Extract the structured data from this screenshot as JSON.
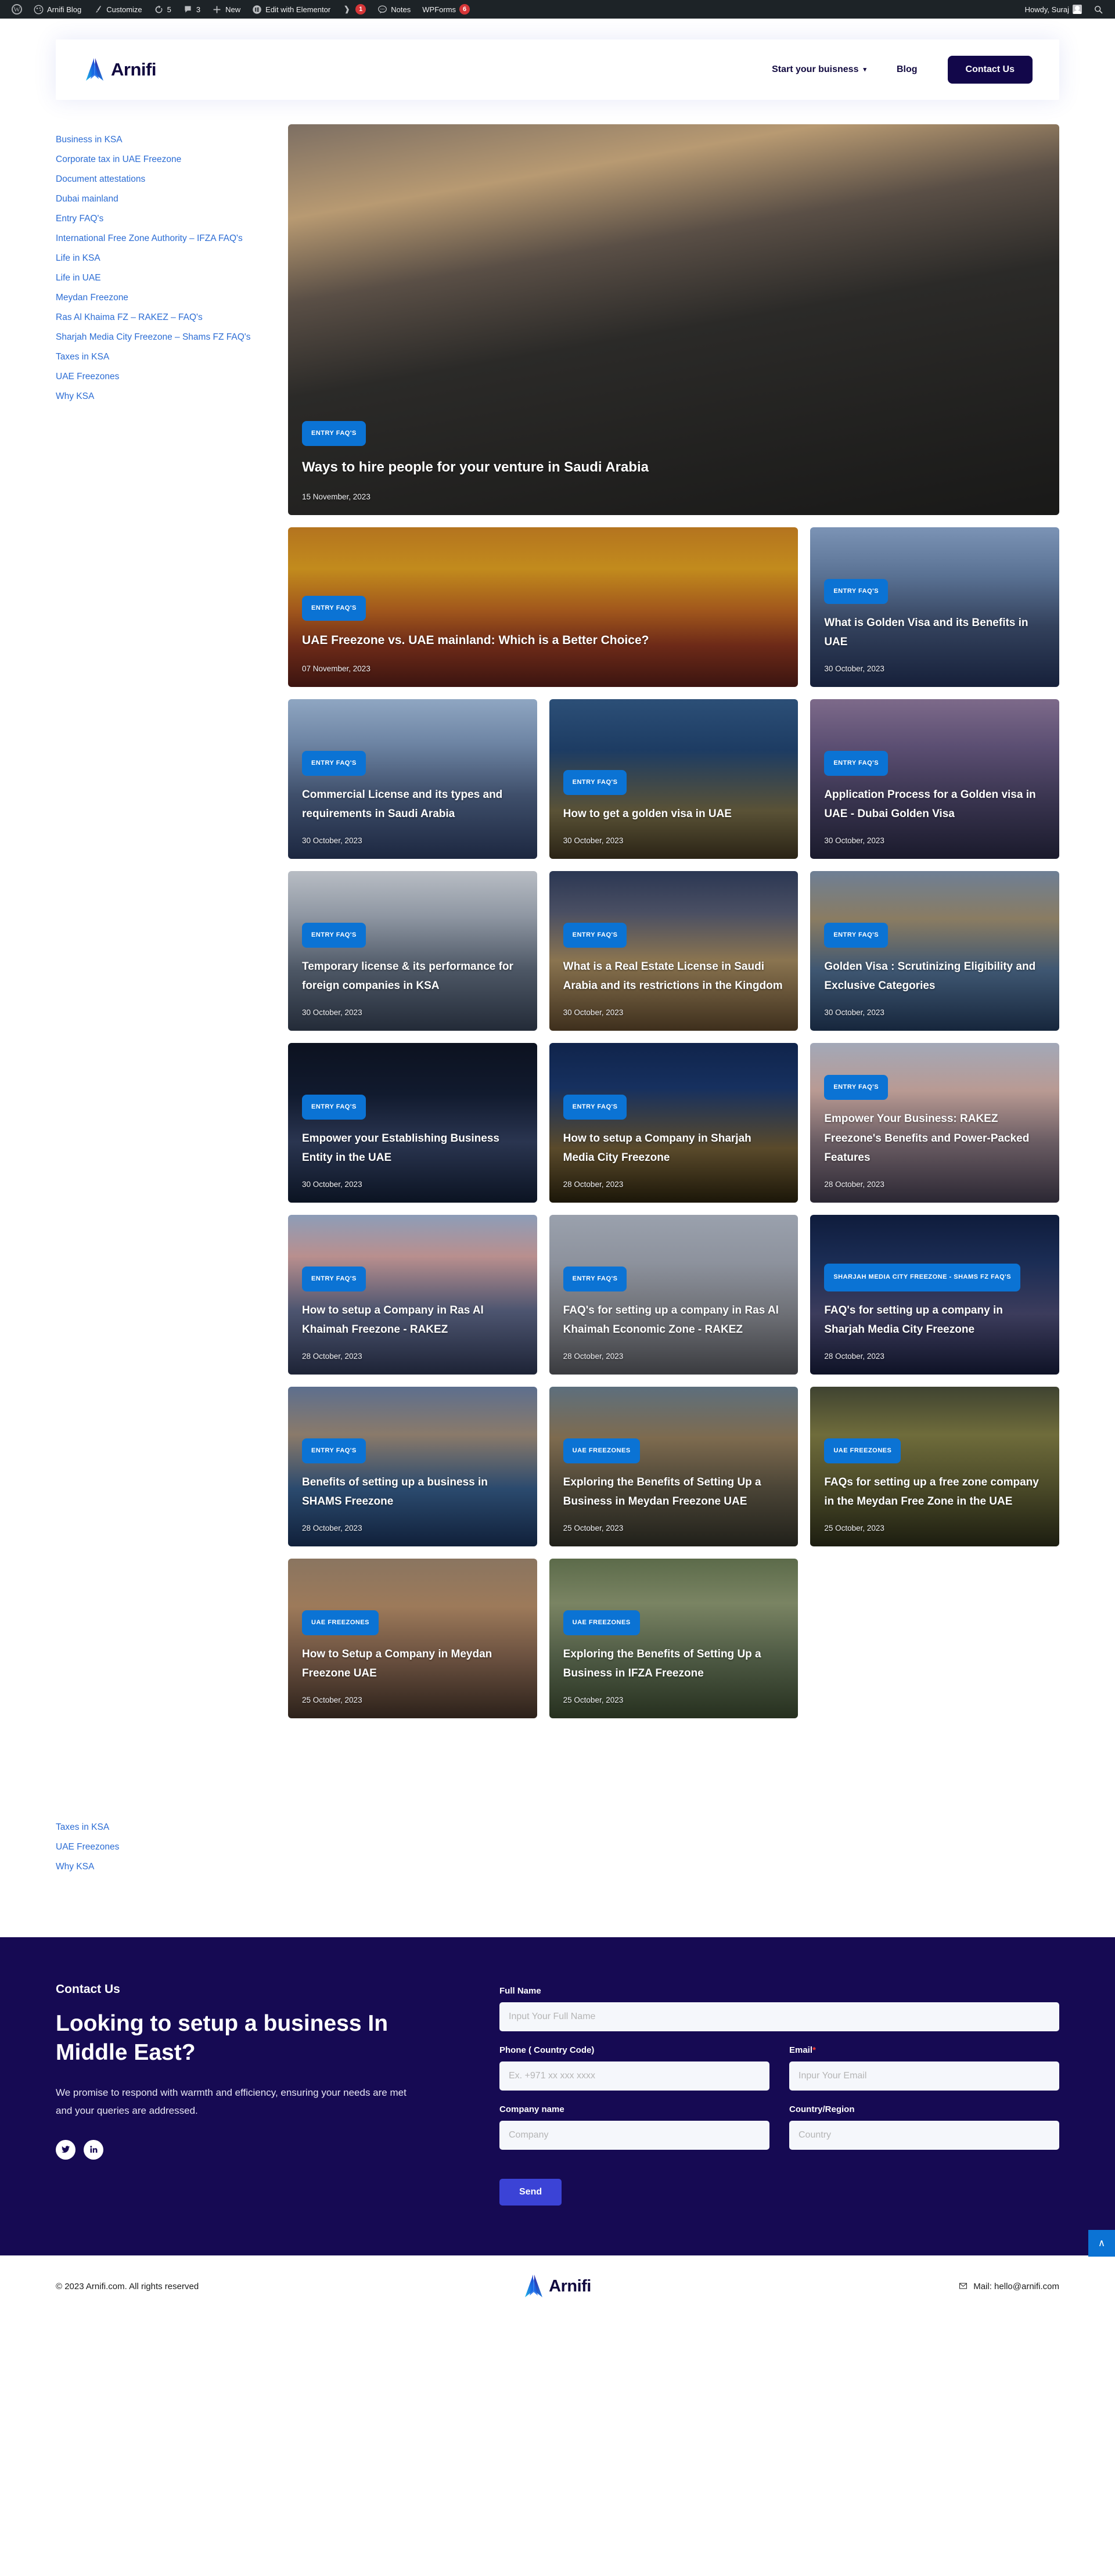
{
  "admin_bar": {
    "site_name": "Arnifi Blog",
    "customize": "Customize",
    "updates_count": "5",
    "comments_count": "3",
    "new": "New",
    "elementor": "Edit with Elementor",
    "yoast_badge": "1",
    "notes": "Notes",
    "wpforms": "WPForms",
    "wpforms_badge": "6",
    "howdy": "Howdy, Suraj"
  },
  "header": {
    "brand": "Arnifi",
    "nav": [
      {
        "label": "Start your buisness",
        "has_caret": true
      },
      {
        "label": "Blog",
        "has_caret": false
      }
    ],
    "cta": "Contact Us"
  },
  "sidebar": {
    "items": [
      "Business in KSA",
      "Corporate tax in UAE Freezone",
      "Document attestations",
      "Dubai mainland",
      "Entry FAQ's",
      "International Free Zone Authority – IFZA FAQ's",
      "Life in KSA",
      "Life in UAE",
      "Meydan Freezone",
      "Ras Al Khaima FZ – RAKEZ – FAQ's",
      "Sharjah Media City Freezone – Shams FZ FAQ's",
      "Taxes in KSA",
      "UAE Freezones",
      "Why KSA"
    ],
    "lower_items": [
      "Taxes in KSA",
      "UAE Freezones",
      "Why KSA"
    ]
  },
  "posts": [
    {
      "category": "ENTRY FAQ'S",
      "title": "Ways to hire people for your venture in Saudi Arabia",
      "date": "15 November, 2023",
      "theme": "ph-road"
    },
    {
      "category": "ENTRY FAQ'S",
      "title": "UAE Freezone vs. UAE mainland: Which is a Better Choice?",
      "date": "07 November, 2023",
      "theme": "ph-burj"
    },
    {
      "category": "ENTRY FAQ'S",
      "title": "What is Golden Visa and its Benefits in UAE",
      "date": "30 October, 2023",
      "theme": "ph-marina"
    },
    {
      "category": "ENTRY FAQ'S",
      "title": "Commercial License and its types and requirements in Saudi Arabia",
      "date": "30 October, 2023",
      "theme": "ph-industry"
    },
    {
      "category": "ENTRY FAQ'S",
      "title": "How to get a golden visa in UAE",
      "date": "30 October, 2023",
      "theme": "ph-burjkh"
    },
    {
      "category": "ENTRY FAQ'S",
      "title": "Application Process for a Golden visa in UAE - Dubai Golden Visa",
      "date": "30 October, 2023",
      "theme": "ph-dusk"
    },
    {
      "category": "ENTRY FAQ'S",
      "title": "Temporary license & its performance for foreign companies in KSA",
      "date": "30 October, 2023",
      "theme": "ph-riyadh"
    },
    {
      "category": "ENTRY FAQ'S",
      "title": "What is a Real Estate License in Saudi Arabia and its restrictions in the Kingdom",
      "date": "30 October, 2023",
      "theme": "ph-kingdom"
    },
    {
      "category": "ENTRY FAQ'S",
      "title": "Golden Visa : Scrutinizing Eligibility and Exclusive Categories",
      "date": "30 October, 2023",
      "theme": "ph-golden"
    },
    {
      "category": "ENTRY FAQ'S",
      "title": "Empower your Establishing Business Entity in the UAE",
      "date": "30 October, 2023",
      "theme": "ph-night"
    },
    {
      "category": "ENTRY FAQ'S",
      "title": "How to setup a Company in Sharjah Media City Freezone",
      "date": "28 October, 2023",
      "theme": "ph-sharjah"
    },
    {
      "category": "ENTRY FAQ'S",
      "title": "Empower Your Business: RAKEZ Freezone's Benefits and Power-Packed Features",
      "date": "28 October, 2023",
      "theme": "ph-rakez"
    },
    {
      "category": "ENTRY FAQ'S",
      "title": "How to setup a Company in Ras Al Khaimah Freezone - RAKEZ",
      "date": "28 October, 2023",
      "theme": "ph-coast"
    },
    {
      "category": "ENTRY FAQ'S",
      "title": "FAQ's for setting up a company in Ras Al Khaimah Economic Zone - RAKEZ",
      "date": "28 October, 2023",
      "theme": "ph-rakcity"
    },
    {
      "category": "SHARJAH MEDIA CITY FREEZONE - SHAMS FZ FAQ'S",
      "title": "FAQ's for setting up a company in Sharjah Media City Freezone",
      "date": "28 October, 2023",
      "theme": "ph-shams"
    },
    {
      "category": "ENTRY FAQ'S",
      "title": "Benefits of setting up a business in SHAMS Freezone",
      "date": "28 October, 2023",
      "theme": "ph-shamsfz"
    },
    {
      "category": "UAE FREEZONES",
      "title": "Exploring the Benefits of Setting Up a Business in Meydan Freezone UAE",
      "date": "25 October, 2023",
      "theme": "ph-meydan"
    },
    {
      "category": "UAE FREEZONES",
      "title": "FAQs for setting up a free zone company in the Meydan Free Zone in the UAE",
      "date": "25 October, 2023",
      "theme": "ph-meydan2"
    },
    {
      "category": "UAE FREEZONES",
      "title": "How to Setup a Company in Meydan Freezone UAE",
      "date": "25 October, 2023",
      "theme": "ph-meydan3"
    },
    {
      "category": "UAE FREEZONES",
      "title": "Exploring the Benefits of Setting Up a Business in IFZA Freezone",
      "date": "25 October, 2023",
      "theme": "ph-ifza"
    }
  ],
  "contact": {
    "kicker": "Contact Us",
    "heading": "Looking to setup a business In Middle East?",
    "subtext": "We promise to respond with warmth and efficiency, ensuring your needs are met and your queries are addressed.",
    "fields": {
      "full_name_label": "Full Name",
      "full_name_placeholder": "Input Your Full Name",
      "full_name_value": "",
      "phone_label": "Phone ( Country Code)",
      "phone_placeholder": "Ex. +971 xx xxx xxxx",
      "phone_value": "",
      "email_label": "Email",
      "email_required": "*",
      "email_placeholder": "Inpur Your Email",
      "email_value": "",
      "company_label": "Company name",
      "company_placeholder": "Company",
      "company_value": "",
      "country_label": "Country/Region",
      "country_placeholder": "Country",
      "country_value": ""
    },
    "submit": "Send"
  },
  "footer": {
    "copyright": "© 2023 Arnifi.com. All rights reserved",
    "brand": "Arnifi",
    "mail": "Mail: hello@arnifi.com",
    "to_top": "∧"
  },
  "colors": {
    "admin_bar": "#1d2327",
    "brand_navy": "#11093f",
    "cta_navy": "#12074a",
    "badge_blue": "#0b73d4",
    "contact_bg": "#160a53",
    "send_blue": "#3b43d6",
    "link_blue": "#2b6cd4"
  }
}
